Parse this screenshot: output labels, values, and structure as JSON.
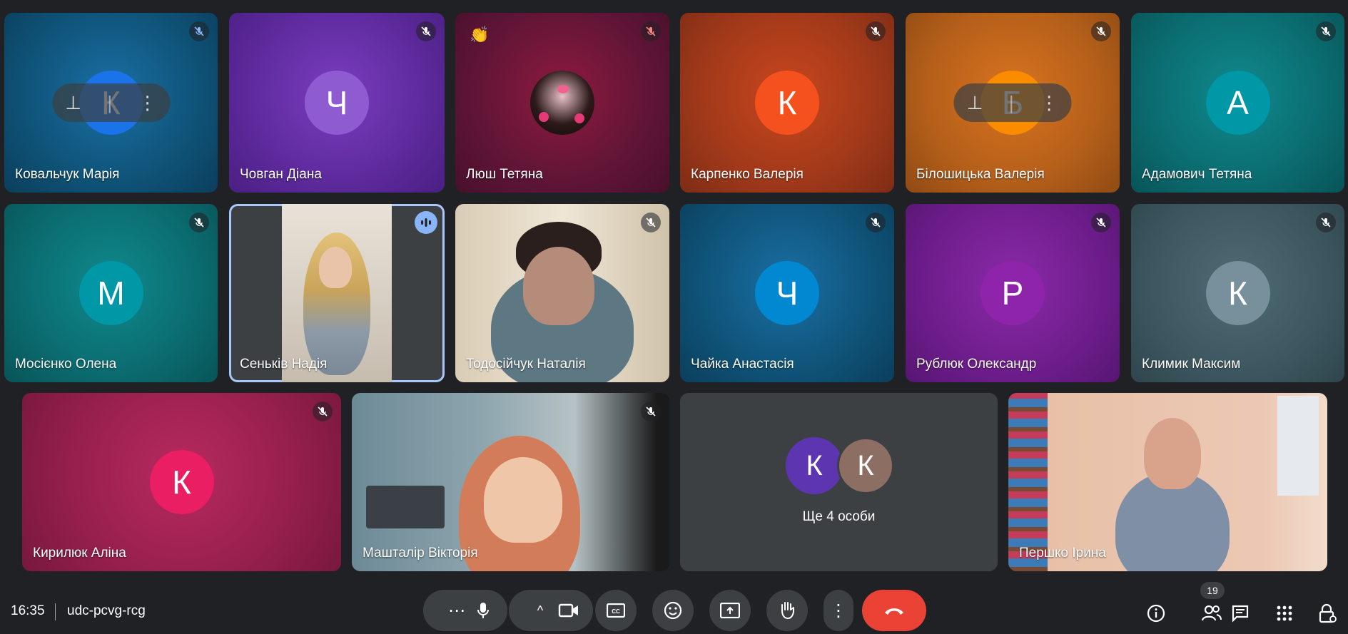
{
  "participants": [
    {
      "name": "Ковальчук Марія",
      "initial": "К"
    },
    {
      "name": "Човган Діана",
      "initial": "Ч"
    },
    {
      "name": "Люш Тетяна",
      "reaction": "👏"
    },
    {
      "name": "Карпенко Валерія",
      "initial": "К"
    },
    {
      "name": "Білошицька Валерія",
      "initial": "Б"
    },
    {
      "name": "Адамович Тетяна",
      "initial": "А"
    },
    {
      "name": "Мосієнко Олена",
      "initial": "М"
    },
    {
      "name": "Сеньків Надія"
    },
    {
      "name": "Тодосійчук Наталія"
    },
    {
      "name": "Чайка Анастасія",
      "initial": "Ч"
    },
    {
      "name": "Рублюк Олександр",
      "initial": "Р"
    },
    {
      "name": "Климик Максим",
      "initial": "К"
    },
    {
      "name": "Кирилюк Аліна",
      "initial": "К"
    },
    {
      "name": "Машталір Вікторія"
    },
    {
      "name": "Першко Ірина"
    }
  ],
  "more": {
    "initials": [
      "К",
      "К"
    ],
    "label": "Ще 4 особи"
  },
  "footer": {
    "time": "16:35",
    "meeting_code": "udc-pcvg-rcg",
    "participant_count": "19"
  },
  "colors": {
    "end_call": "#ea4335",
    "speaking": "#8ab4f8",
    "background": "#202124"
  }
}
